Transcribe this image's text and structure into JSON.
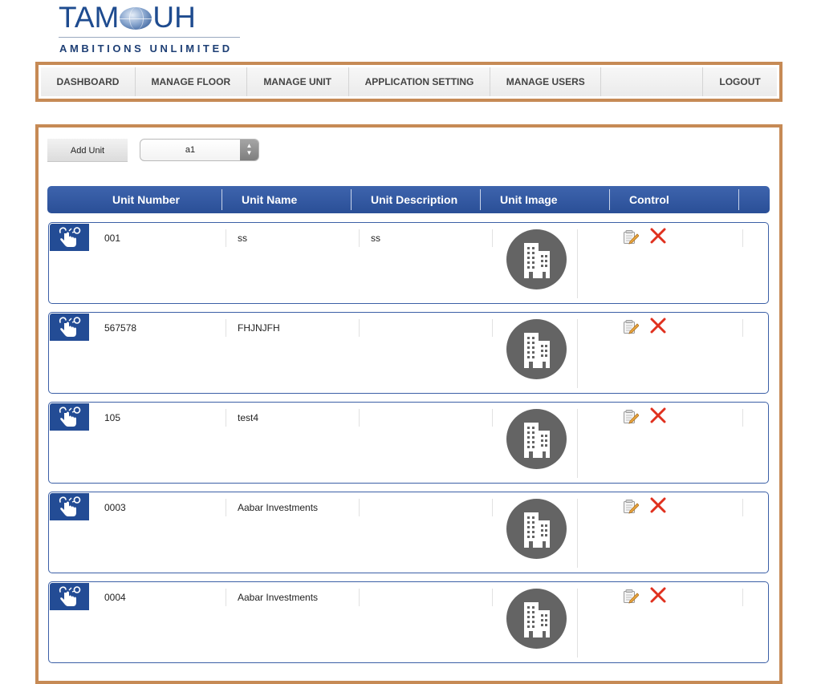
{
  "logo": {
    "wordmark_left": "TAM",
    "wordmark_right": "UH",
    "tagline": "AMBITIONS UNLIMITED",
    "brand_color": "#1e4b8f"
  },
  "nav": {
    "items": [
      {
        "label": "DASHBOARD"
      },
      {
        "label": "MANAGE FLOOR"
      },
      {
        "label": "MANAGE UNIT"
      },
      {
        "label": "APPLICATION SETTING"
      },
      {
        "label": "MANAGE USERS"
      },
      {
        "label": "LOGOUT"
      }
    ],
    "frame_color": "#c68a55"
  },
  "toolbar": {
    "add_unit_label": "Add Unit",
    "floor_select_value": "a1"
  },
  "table": {
    "headers": [
      "Unit Number",
      "Unit Name",
      "Unit Description",
      "Unit Image",
      "Control"
    ],
    "header_color": "#2f559d",
    "rows": [
      {
        "unit_number": "001",
        "unit_name": "ss",
        "unit_description": "ss"
      },
      {
        "unit_number": "567578",
        "unit_name": "FHJNJFH",
        "unit_description": ""
      },
      {
        "unit_number": "105",
        "unit_name": "test4",
        "unit_description": ""
      },
      {
        "unit_number": "0003",
        "unit_name": "Aabar Investments",
        "unit_description": ""
      },
      {
        "unit_number": "0004",
        "unit_name": "Aabar Investments",
        "unit_description": ""
      }
    ],
    "row_icons": {
      "drag": "hand-pointer-icon",
      "image": "building-icon",
      "edit": "edit-pencil-icon",
      "delete": "delete-x-icon"
    }
  }
}
